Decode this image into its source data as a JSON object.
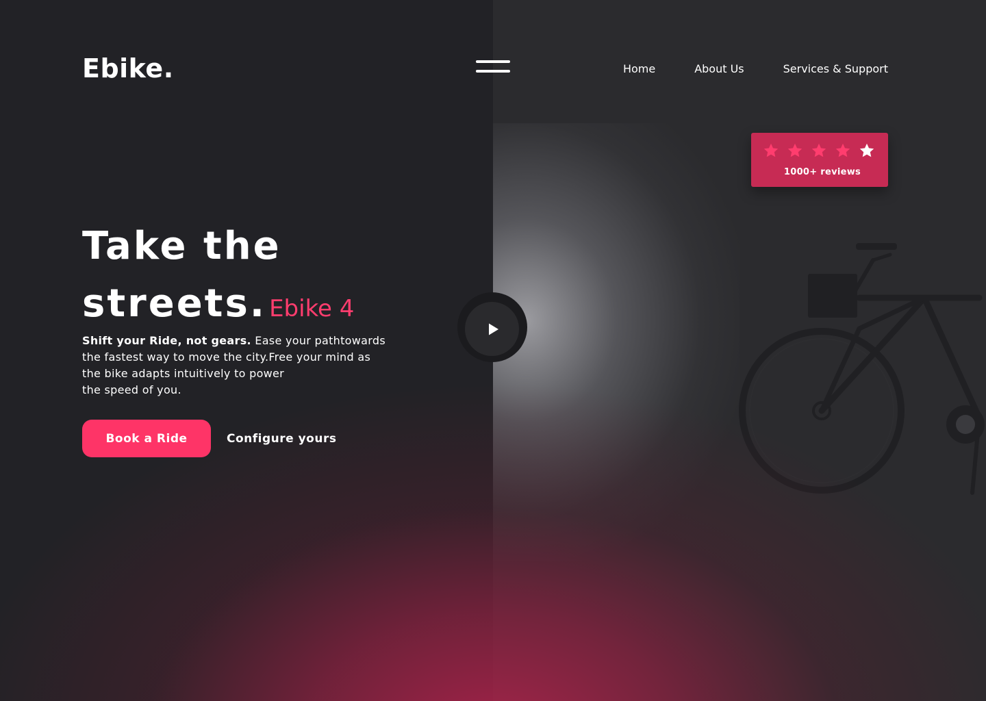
{
  "header": {
    "logo": "Ebike.",
    "nav": [
      {
        "label": "Home"
      },
      {
        "label": "About Us"
      },
      {
        "label": "Services & Support"
      }
    ]
  },
  "rating": {
    "stars_filled": 4,
    "stars_total": 5,
    "reviews_label": "1000+ reviews"
  },
  "hero": {
    "title_line1": "Take the",
    "title_line2": "streets.",
    "model": "Ebike 4",
    "lead_bold": "Shift your Ride, not gears.",
    "lead_rest": "Ease your pathtowards",
    "body_lines": [
      "the fastest way to move the city.Free your mind as",
      "the bike adapts intuitively to power",
      "the speed of you."
    ],
    "cta_primary": "Book a Ride",
    "cta_secondary": "Configure yours"
  },
  "colors": {
    "background": "#222226",
    "accent": "#fe3467",
    "card": "#c72b54",
    "text": "#ffffff"
  },
  "icons": {
    "menu": "hamburger-menu-icon",
    "play": "play-icon",
    "rating": "star-icon"
  }
}
